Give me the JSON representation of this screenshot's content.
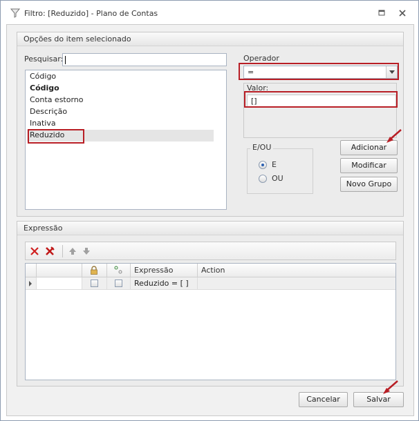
{
  "window": {
    "title": "Filtro: [Reduzido] - Plano de Contas",
    "title_icon": "filter-icon"
  },
  "options_group": {
    "header": "Opções do item selecionado",
    "search": {
      "label": "Pesquisar:",
      "value": ""
    },
    "fields": [
      "Código",
      "Código",
      "Conta estorno",
      "Descrição",
      "Inativa",
      "Reduzido"
    ],
    "selected_field": "Reduzido",
    "operator": {
      "label": "Operador",
      "value": "="
    },
    "valor": {
      "label": "Valor:",
      "value": "[]"
    },
    "eou": {
      "legend": "E/OU",
      "option_e": "E",
      "option_ou": "OU",
      "selected": "E"
    },
    "buttons": {
      "add": "Adicionar",
      "modify": "Modificar",
      "new_group": "Novo Grupo"
    }
  },
  "expression_group": {
    "header": "Expressão",
    "grid": {
      "columns": [
        "",
        "",
        "",
        "",
        "Expressão",
        "Action"
      ],
      "rows": [
        {
          "expression": "Reduzido = [ ]",
          "action": ""
        }
      ]
    }
  },
  "footer": {
    "cancel": "Cancelar",
    "save": "Salvar"
  },
  "colors": {
    "highlight": "#b81e25",
    "selection_row": "#e5e5e5"
  }
}
